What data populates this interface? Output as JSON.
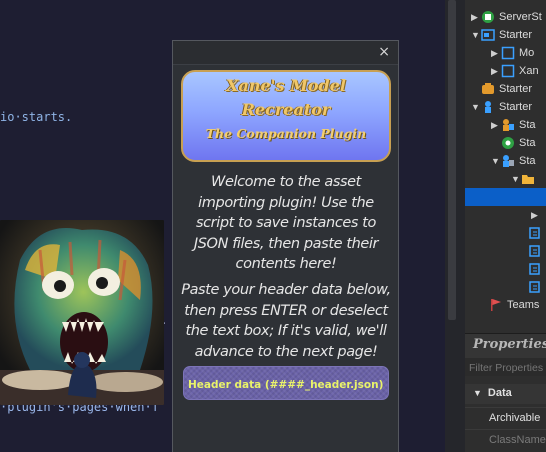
{
  "editor": {
    "line1": "io·starts.",
    "line2": "·plugin's·pages·when·f",
    "line3": ">"
  },
  "plugin": {
    "close_glyph": "×",
    "banner_title": "Xane's Model Recreator",
    "banner_subtitle": "The Companion Plugin",
    "welcome_text": "Welcome to the asset importing plugin! Use the script to save instances to JSON files, then paste their contents here!",
    "instructions_text": "Paste your header data below, then press ENTER or deselect the text box; If it's valid, we'll advance to the next page!",
    "header_input_placeholder": "Header data (####_header.json)",
    "header_input_value": ""
  },
  "explorer": {
    "items": [
      {
        "label": "ServerSt",
        "icon": "server-storage-icon",
        "expanded": false
      },
      {
        "label": "Starter",
        "icon": "starter-gui-icon",
        "expanded": true
      },
      {
        "label": "Mo",
        "icon": "frame-icon",
        "expanded": false
      },
      {
        "label": "Xan",
        "icon": "frame-icon",
        "expanded": false
      },
      {
        "label": "Starter",
        "icon": "starter-pack-icon",
        "expanded": false
      },
      {
        "label": "Starter",
        "icon": "starter-player-icon",
        "expanded": true
      },
      {
        "label": "Sta",
        "icon": "starter-character-scripts-icon",
        "expanded": false
      },
      {
        "label": "Sta",
        "icon": "starter-player-scripts-icon",
        "expanded": false
      },
      {
        "label": "Sta",
        "icon": "starter-scripts-icon",
        "expanded": true
      },
      {
        "label": "",
        "icon": "folder-icon",
        "expanded": true
      },
      {
        "label": "",
        "icon": "selected-item",
        "expanded": false
      },
      {
        "label": "Teams",
        "icon": "teams-icon",
        "expanded": false
      }
    ]
  },
  "properties": {
    "title": "Properties",
    "filter_placeholder": "Filter Properties",
    "section": "Data",
    "rows": [
      "Archivable",
      "ClassName"
    ]
  }
}
